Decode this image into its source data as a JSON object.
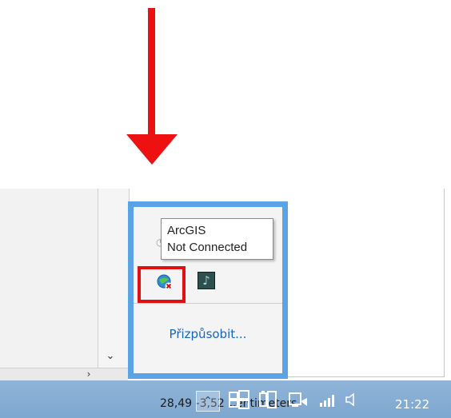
{
  "annotation": {
    "arrow_color": "#ee1111",
    "highlight_color": "#e01010"
  },
  "tooltip": {
    "title": "ArcGIS",
    "status": "Not Connected"
  },
  "popup": {
    "customize_label": "Přizpůsobit...",
    "border_color": "#5aa3e6",
    "icons": [
      {
        "name": "arcgis-icon",
        "tooltip": "ArcGIS"
      },
      {
        "name": "music-app-icon"
      }
    ]
  },
  "taskbar": {
    "coordinates_text": "28,49 -3,52 Centimeters",
    "clock": "21:22",
    "tray_icons": [
      "chevron-up-icon",
      "windows-icon",
      "battery-icon",
      "screen-icon",
      "network-signal-icon",
      "volume-icon"
    ]
  },
  "scrollbars": {
    "vertical_arrow": "chevron-down-icon",
    "horizontal_arrow": "chevron-right-icon"
  }
}
